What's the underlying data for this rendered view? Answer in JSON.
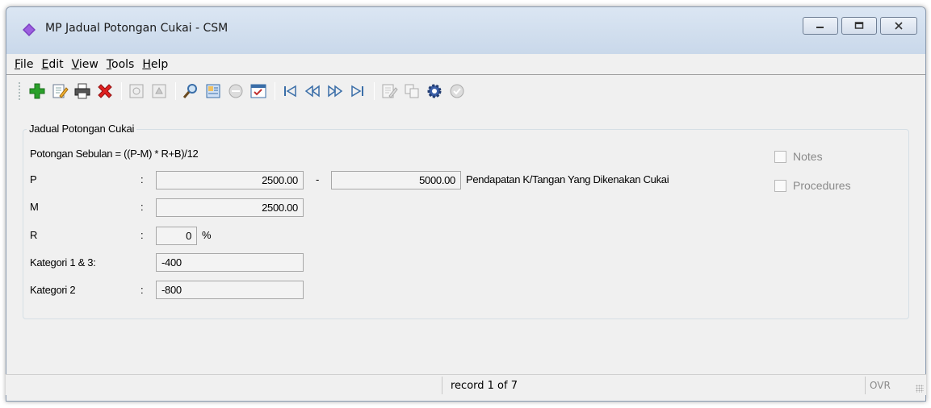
{
  "window": {
    "title": "MP Jadual Potongan Cukai - CSM",
    "app_icon": "purple-diamond-icon",
    "controls": [
      "minimize-icon",
      "maximize-icon",
      "close-icon"
    ]
  },
  "menu": {
    "items": [
      {
        "label": "File",
        "access_key": "F",
        "rest": "ile"
      },
      {
        "label": "Edit",
        "access_key": "E",
        "rest": "dit"
      },
      {
        "label": "View",
        "access_key": "V",
        "rest": "iew"
      },
      {
        "label": "Tools",
        "access_key": "T",
        "rest": "ools"
      },
      {
        "label": "Help",
        "access_key": "H",
        "rest": "elp"
      }
    ]
  },
  "toolbar": {
    "buttons": [
      {
        "icon": "add-icon",
        "enabled": true
      },
      {
        "icon": "edit-icon",
        "enabled": true
      },
      {
        "icon": "print-icon",
        "enabled": true
      },
      {
        "icon": "delete-icon",
        "enabled": true
      },
      {
        "icon": "save-icon",
        "enabled": false
      },
      {
        "icon": "cancel-icon",
        "enabled": false
      },
      {
        "icon": "search-icon",
        "enabled": true
      },
      {
        "icon": "find-record-icon",
        "enabled": true
      },
      {
        "icon": "clear-filter-icon",
        "enabled": false
      },
      {
        "icon": "calendar-icon",
        "enabled": true
      },
      {
        "icon": "first-record-icon",
        "enabled": true
      },
      {
        "icon": "previous-record-icon",
        "enabled": true
      },
      {
        "icon": "next-record-icon",
        "enabled": true
      },
      {
        "icon": "last-record-icon",
        "enabled": true
      },
      {
        "icon": "notes-icon",
        "enabled": false
      },
      {
        "icon": "copy-icon",
        "enabled": false
      },
      {
        "icon": "settings-gear-icon",
        "enabled": true
      },
      {
        "icon": "help-circle-icon",
        "enabled": false
      }
    ],
    "colors": {
      "add": "#2aa02a",
      "delete": "#e02020",
      "gear": "#3b5fa8"
    }
  },
  "form": {
    "group_title": "Jadual Potongan Cukai",
    "formula": "Potongan Sebulan = ((P-M) * R+B)/12",
    "p_label": "P",
    "p_from": "2500.00",
    "p_dash": "-",
    "p_to": "5000.00",
    "p_description": "Pendapatan K/Tangan Yang Dikenakan Cukai",
    "m_label": "M",
    "m_value": "2500.00",
    "r_label": "R",
    "r_value": "0",
    "r_unit": "%",
    "kategori13_label": "Kategori 1 & 3:",
    "kategori13_value": "-400",
    "kategori2_label": "Kategori 2",
    "kategori2_value": "-800",
    "colon": ":",
    "notes_label": "Notes",
    "procedures_label": "Procedures"
  },
  "status": {
    "record": "record 1 of 7",
    "ovr": "OVR"
  }
}
